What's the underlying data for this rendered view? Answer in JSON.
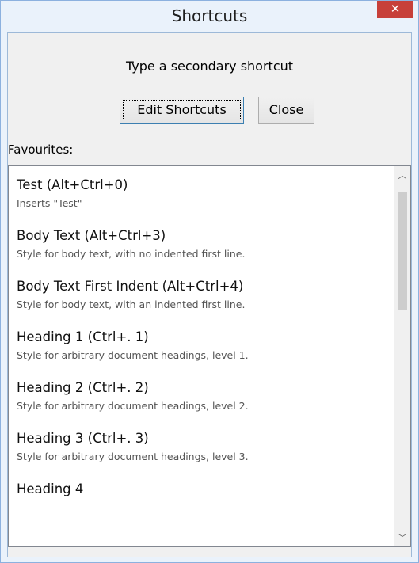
{
  "window": {
    "title": "Shortcuts",
    "close_glyph": "✕"
  },
  "prompt": "Type a secondary shortcut",
  "buttons": {
    "edit": "Edit Shortcuts",
    "close": "Close"
  },
  "favourites": {
    "label": "Favourites:",
    "items": [
      {
        "title": "Test (Alt+Ctrl+0)",
        "desc": "Inserts \"Test\""
      },
      {
        "title": "Body Text (Alt+Ctrl+3)",
        "desc": "Style for body text, with no indented first line."
      },
      {
        "title": "Body Text First Indent (Alt+Ctrl+4)",
        "desc": "Style for body text, with an indented first line."
      },
      {
        "title": "Heading 1 (Ctrl+. 1)",
        "desc": "Style for arbitrary document headings, level 1."
      },
      {
        "title": "Heading 2 (Ctrl+. 2)",
        "desc": "Style for arbitrary document headings, level 2."
      },
      {
        "title": "Heading 3 (Ctrl+. 3)",
        "desc": "Style for arbitrary document headings, level 3."
      },
      {
        "title": "Heading 4",
        "desc": ""
      }
    ]
  },
  "scrollbar": {
    "up_glyph": "︿",
    "down_glyph": "﹀",
    "up_icon": "chevron-up-icon",
    "down_icon": "chevron-down-icon"
  },
  "colors": {
    "close_button": "#c7403a",
    "title_bar": "#eaf2fb",
    "dialog_background": "#f0f0f0",
    "focus_border": "#3c7fb1"
  }
}
